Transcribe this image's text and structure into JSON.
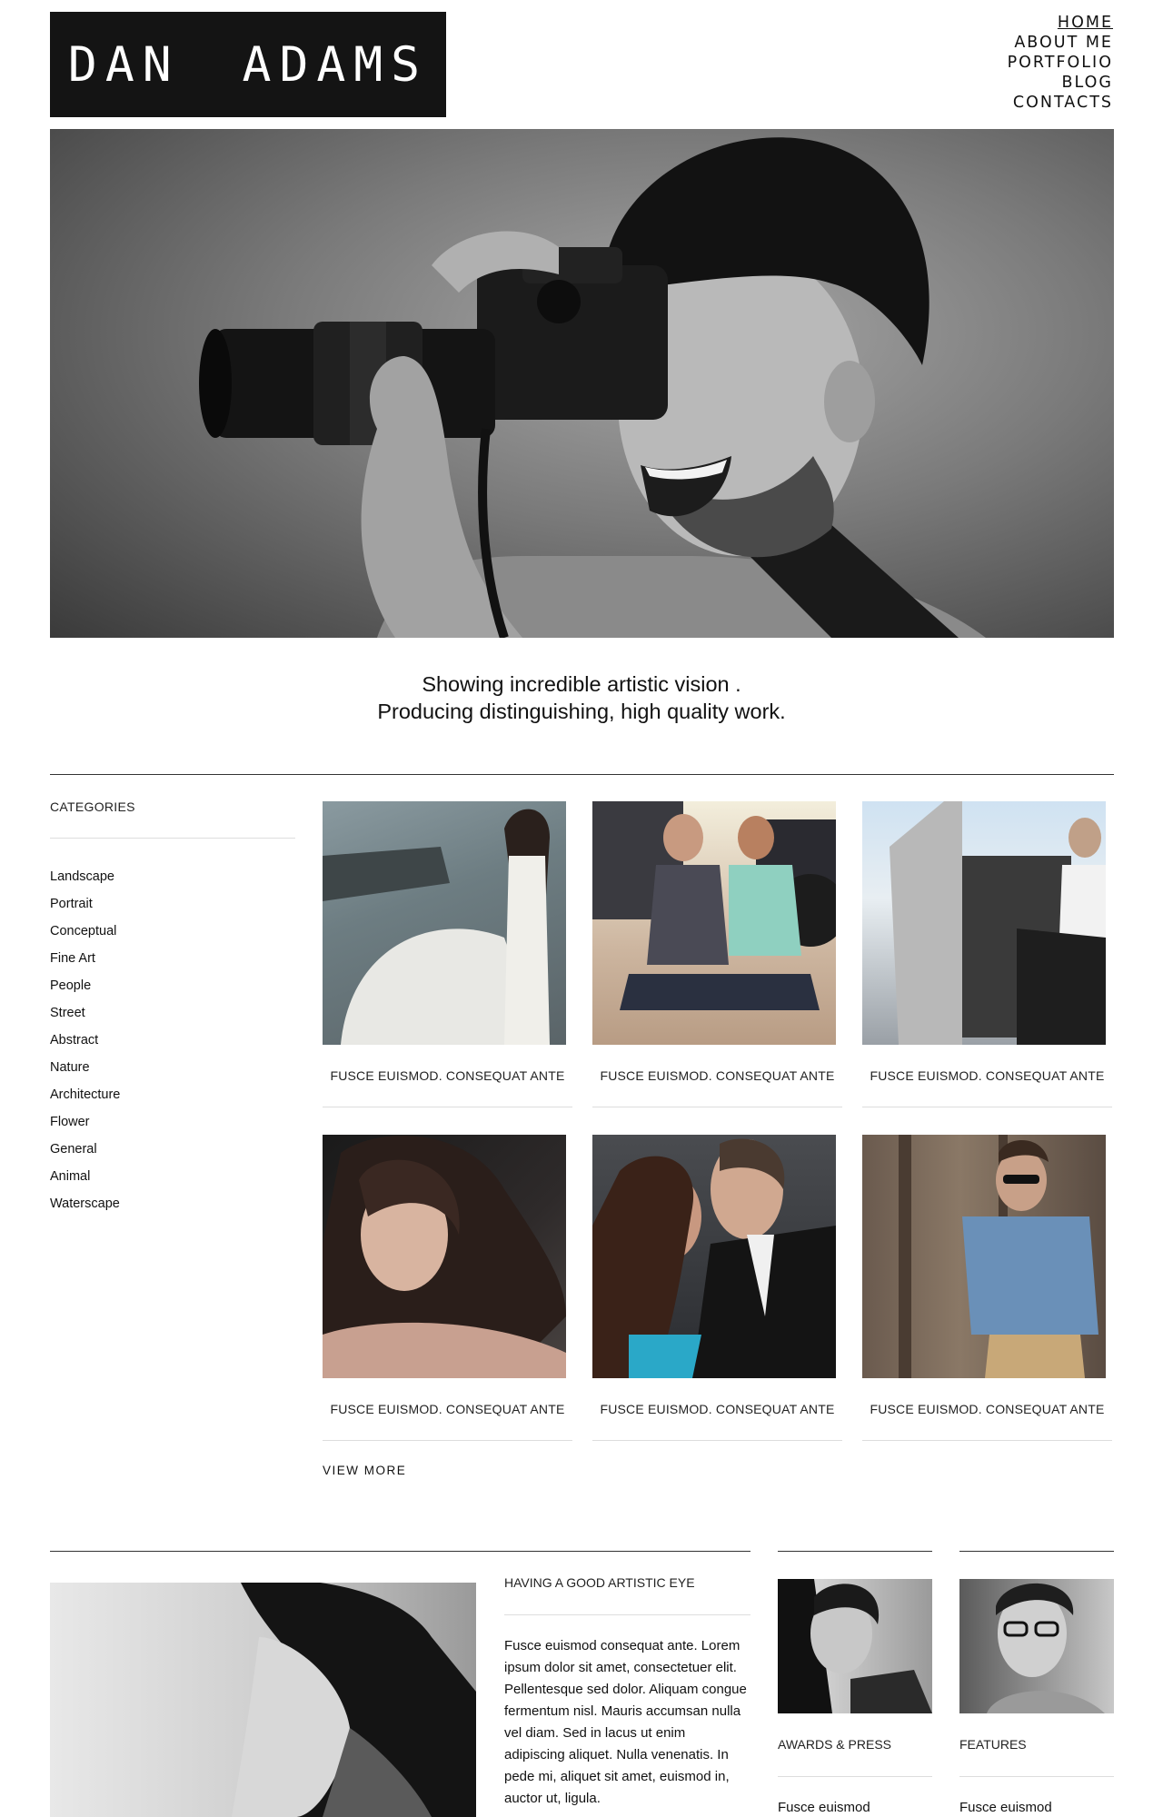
{
  "brand": {
    "logo_text": "DAN ADAMS"
  },
  "nav": {
    "items": [
      {
        "label": "HOME",
        "active": true
      },
      {
        "label": "ABOUT ME",
        "active": false
      },
      {
        "label": "PORTFOLIO",
        "active": false
      },
      {
        "label": "BLOG",
        "active": false
      },
      {
        "label": "CONTACTS",
        "active": false
      }
    ]
  },
  "hero": {
    "image": "photographer-with-camera-photo"
  },
  "tagline": {
    "line1": "Showing incredible artistic vision .",
    "line2": "Producing distinguishing, high quality work."
  },
  "categories": {
    "title": "CATEGORIES",
    "items": [
      "Landscape",
      "Portrait",
      "Conceptual",
      "Fine Art",
      "People",
      "Street",
      "Abstract",
      "Nature",
      "Architecture",
      "Flower",
      "General",
      "Animal",
      "Waterscape"
    ]
  },
  "gallery": {
    "items": [
      {
        "caption": "FUSCE EUISMOD. CONSEQUAT ANTE",
        "image": "woman-white-dress-cliff"
      },
      {
        "caption": "FUSCE EUISMOD. CONSEQUAT ANTE",
        "image": "couple-motorcycle"
      },
      {
        "caption": "FUSCE EUISMOD. CONSEQUAT ANTE",
        "image": "man-in-car"
      },
      {
        "caption": "FUSCE EUISMOD. CONSEQUAT ANTE",
        "image": "woman-long-hair-portrait"
      },
      {
        "caption": "FUSCE EUISMOD. CONSEQUAT ANTE",
        "image": "couple-embrace"
      },
      {
        "caption": "FUSCE EUISMOD. CONSEQUAT ANTE",
        "image": "man-denim-jacket"
      }
    ],
    "view_more": "VIEW MORE"
  },
  "about": {
    "title": "HAVING A GOOD ARTISTIC EYE",
    "text": "Fusce euismod consequat ante. Lorem ipsum dolor sit amet, consectetuer elit. Pellentesque sed dolor. Aliquam congue fermentum nisl. Mauris accumsan nulla vel diam. Sed in lacus ut enim adipiscing aliquet. Nulla venenatis. In pede mi, aliquet sit amet, euismod in, auctor ut, ligula."
  },
  "awards": {
    "title": "AWARDS & PRESS",
    "text": "Fusce euismod"
  },
  "features": {
    "title": "FEATURES",
    "text": "Fusce euismod"
  },
  "colors": {
    "logo_bg": "#141414",
    "text": "#111111",
    "rule": "#dddddd"
  }
}
